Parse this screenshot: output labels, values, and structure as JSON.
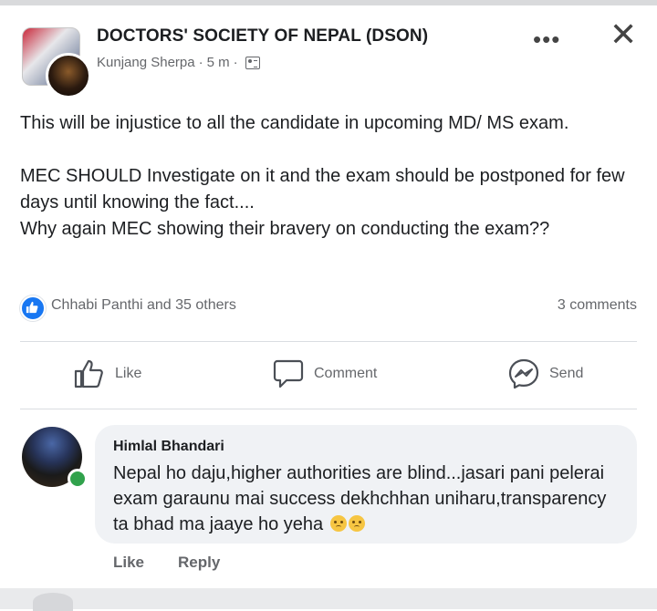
{
  "post": {
    "group_name": "DOCTORS' SOCIETY OF NEPAL (DSON)",
    "author": "Kunjang Sherpa",
    "separator1": "·",
    "time": "5 m",
    "separator2": "·",
    "privacy_icon": "group-privacy-icon",
    "more_label": "•••",
    "close_label": "✕",
    "text": "This will be injustice to all the candidate in upcoming  MD/ MS exam.\n\nMEC SHOULD Investigate on it and the exam should be postponed for few days until knowing the fact....\nWhy again MEC showing their bravery on conducting the exam??"
  },
  "reactions": {
    "summary": "Chhabi Panthi and 35 others",
    "comments_count": "3 comments",
    "reaction_icon": "like-reaction-icon",
    "accent_color": "#1877f2"
  },
  "actions": {
    "like": "Like",
    "comment": "Comment",
    "send": "Send"
  },
  "comment": {
    "name": "Himlal Bhandari",
    "text": "Nepal ho daju,higher authorities are blind...jasari pani pelerai exam garaunu mai success dekhchhan uniharu,transparency ta bhad ma jaaye ho yeha",
    "emoji_icon": "sad-face-emoji-icon",
    "online_color": "#31a24c",
    "like_label": "Like",
    "reply_label": "Reply"
  }
}
